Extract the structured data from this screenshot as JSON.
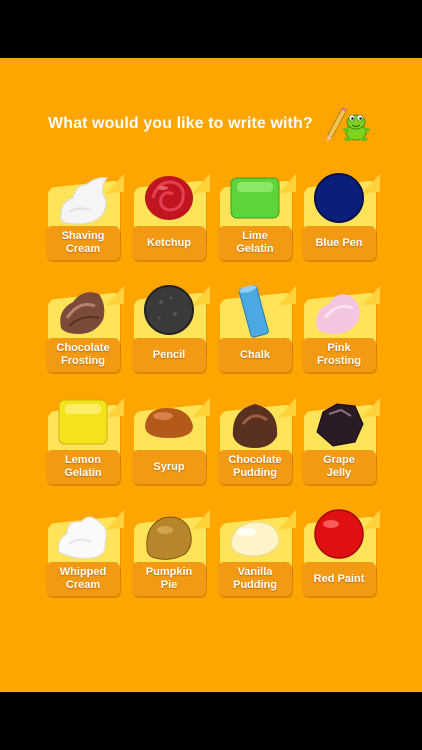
{
  "prompt": "What would you like to write with?",
  "tiles": [
    {
      "label": "Shaving\nCream",
      "icon": "shaving-cream-icon"
    },
    {
      "label": "Ketchup",
      "icon": "ketchup-icon"
    },
    {
      "label": "Lime\nGelatin",
      "icon": "lime-gelatin-icon"
    },
    {
      "label": "Blue Pen",
      "icon": "blue-pen-icon"
    },
    {
      "label": "Chocolate\nFrosting",
      "icon": "chocolate-frosting-icon"
    },
    {
      "label": "Pencil",
      "icon": "pencil-icon"
    },
    {
      "label": "Chalk",
      "icon": "chalk-icon"
    },
    {
      "label": "Pink\nFrosting",
      "icon": "pink-frosting-icon"
    },
    {
      "label": "Lemon\nGelatin",
      "icon": "lemon-gelatin-icon"
    },
    {
      "label": "Syrup",
      "icon": "syrup-icon"
    },
    {
      "label": "Chocolate\nPudding",
      "icon": "chocolate-pudding-icon"
    },
    {
      "label": "Grape\nJelly",
      "icon": "grape-jelly-icon"
    },
    {
      "label": "Whipped\nCream",
      "icon": "whipped-cream-icon"
    },
    {
      "label": "Pumpkin\nPie",
      "icon": "pumpkin-pie-icon"
    },
    {
      "label": "Vanilla\nPudding",
      "icon": "vanilla-pudding-icon"
    },
    {
      "label": "Red Paint",
      "icon": "red-paint-icon"
    }
  ],
  "colors": {
    "background": "#FFA500",
    "card": "#FFE45A",
    "label_box": "#F39A14",
    "letterbox": "#000000"
  }
}
